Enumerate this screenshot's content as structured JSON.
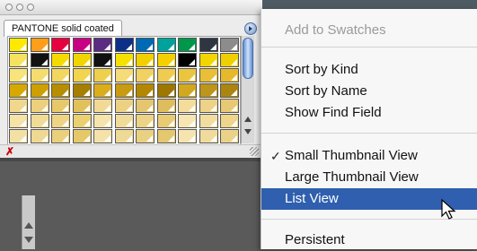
{
  "panel": {
    "tab_label": "PANTONE solid coated",
    "swatch_colors": [
      [
        "#ffe900",
        "#ff9e18",
        "#e7003f",
        "#c80083",
        "#5a2d82",
        "#0d2f87",
        "#0069b4",
        "#00a39b",
        "#00974a",
        "#2f3541",
        "#8c8c8c"
      ],
      [
        "#f5e35f",
        "#111111",
        "#f5da00",
        "#f2d400",
        "#111111",
        "#f6e000",
        "#f2d000",
        "#f4d000",
        "#000000",
        "#f1d600",
        "#f0cf00"
      ],
      [
        "#f8e47a",
        "#f5dc6e",
        "#f3d660",
        "#f2d44f",
        "#eed04d",
        "#f5dc78",
        "#f1d162",
        "#efcb4f",
        "#ecc540",
        "#e8bf36",
        "#e5b92b"
      ],
      [
        "#d6a800",
        "#cda000",
        "#b88e00",
        "#a67f00",
        "#d9ad1c",
        "#c99b10",
        "#b38700",
        "#9e7700",
        "#d2a821",
        "#bd951a",
        "#aa8510"
      ],
      [
        "#f0d78c",
        "#ecd07c",
        "#e7c86a",
        "#e2c05a",
        "#f2da95",
        "#ecd183",
        "#e5c66f",
        "#dfbd5e",
        "#f3dc9c",
        "#edd287",
        "#e7c874"
      ],
      [
        "#f5e3a7",
        "#f1dc97",
        "#eed484",
        "#ead070",
        "#f6e4ad",
        "#f1db9a",
        "#edd386",
        "#e9cb73",
        "#f7e6b3",
        "#f2dda0",
        "#eed58b"
      ],
      [
        "#f3e0a4",
        "#efd892",
        "#ead07d",
        "#e5c869",
        "#f4e2aa",
        "#efd996",
        "#ead082",
        "#e4c76e",
        "#f5e4b0",
        "#f0db9c",
        "#ebd288"
      ]
    ]
  },
  "menu": {
    "items": [
      {
        "label": "Add to Swatches",
        "state": "disabled",
        "checked": false
      },
      {
        "label": "Sort by Kind",
        "state": "normal",
        "checked": false
      },
      {
        "label": "Sort by Name",
        "state": "normal",
        "checked": false
      },
      {
        "label": "Show Find Field",
        "state": "normal",
        "checked": false
      },
      {
        "label": "Small Thumbnail View",
        "state": "normal",
        "checked": true
      },
      {
        "label": "Large Thumbnail View",
        "state": "normal",
        "checked": false
      },
      {
        "label": "List View",
        "state": "highlighted",
        "checked": false
      },
      {
        "label": "Persistent",
        "state": "normal",
        "checked": false
      }
    ],
    "check_glyph": "✓"
  },
  "status": {
    "no_color_glyph": "✗"
  },
  "colors": {
    "menu_highlight": "#2f5fae",
    "disabled_text": "#9a9a9a"
  }
}
